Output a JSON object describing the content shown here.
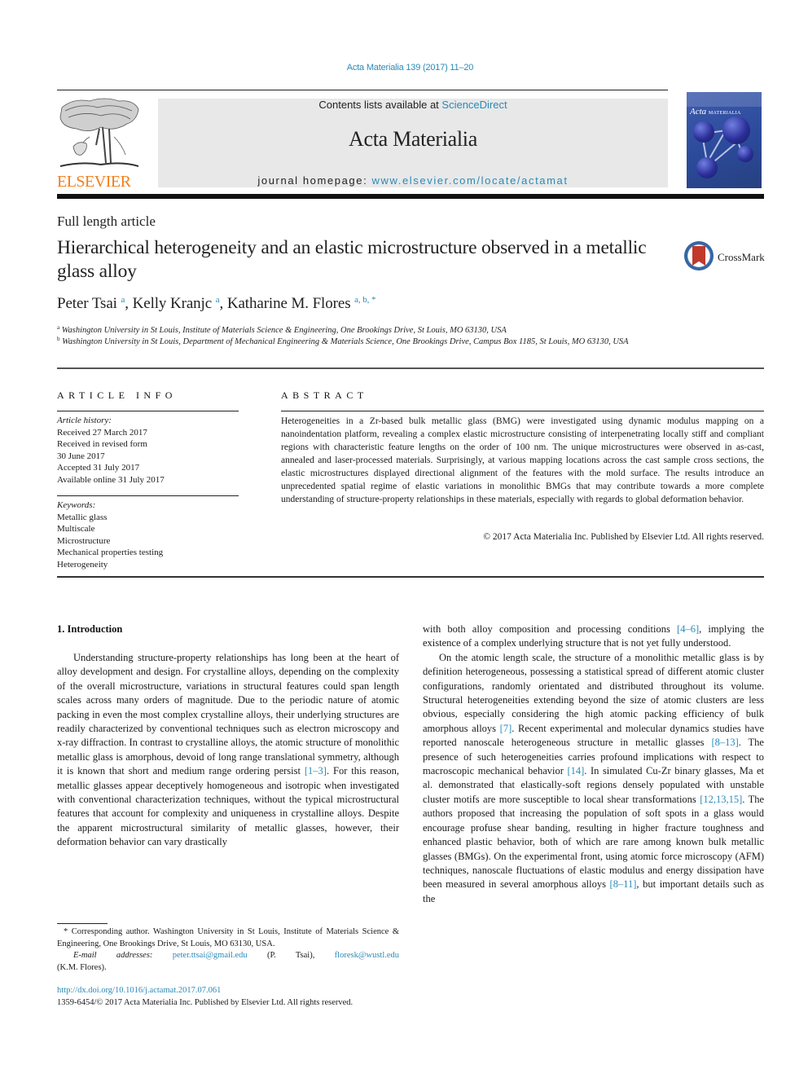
{
  "header": {
    "journal_ref": "Acta Materialia 139 (2017) 11–20",
    "contents_prefix": "Contents lists available at ",
    "contents_link": "ScienceDirect",
    "journal_title": "Acta Materialia",
    "homepage_prefix": "journal homepage: ",
    "homepage_url": "www.elsevier.com/locate/actamat",
    "publisher_logo_text": "ELSEVIER",
    "cover_title_italic": "Acta",
    "cover_title_caps": "MATERIALIA",
    "colors": {
      "link": "#2a8ab8",
      "elsevier_orange": "#f07e1b",
      "header_box": "#e8e8e8",
      "crossmark_red": "#c0392b"
    }
  },
  "article": {
    "type": "Full length article",
    "title": "Hierarchical heterogeneity and an elastic microstructure observed in a metallic glass alloy",
    "crossmark_label": "CrossMark",
    "authors": [
      {
        "name": "Peter Tsai",
        "sup": "a"
      },
      {
        "name": "Kelly Kranjc",
        "sup": "a"
      },
      {
        "name": "Katharine M. Flores",
        "sup": "a, b, *"
      }
    ],
    "affiliations": [
      {
        "mark": "a",
        "text": "Washington University in St Louis, Institute of Materials Science & Engineering, One Brookings Drive, St Louis, MO 63130, USA"
      },
      {
        "mark": "b",
        "text": "Washington University in St Louis, Department of Mechanical Engineering & Materials Science, One Brookings Drive, Campus Box 1185, St Louis, MO 63130, USA"
      }
    ]
  },
  "article_info": {
    "heading": "ARTICLE INFO",
    "history_label": "Article history:",
    "history": [
      "Received 27 March 2017",
      "Received in revised form",
      "30 June 2017",
      "Accepted 31 July 2017",
      "Available online 31 July 2017"
    ],
    "keywords_label": "Keywords:",
    "keywords": [
      "Metallic glass",
      "Multiscale",
      "Microstructure",
      "Mechanical properties testing",
      "Heterogeneity"
    ]
  },
  "abstract": {
    "heading": "ABSTRACT",
    "body": "Heterogeneities in a Zr-based bulk metallic glass (BMG) were investigated using dynamic modulus mapping on a nanoindentation platform, revealing a complex elastic microstructure consisting of interpenetrating locally stiff and compliant regions with characteristic feature lengths on the order of 100 nm. The unique microstructures were observed in as-cast, annealed and laser-processed materials. Surprisingly, at various mapping locations across the cast sample cross sections, the elastic micro­structures displayed directional alignment of the features with the mold surface. The results introduce an unprecedented spatial regime of elastic variations in monolithic BMGs that may contribute towards a more complete understanding of structure-property relationships in these materials, especially with regards to global deformation behavior.",
    "copyright": "© 2017 Acta Materialia Inc. Published by Elsevier Ltd. All rights reserved."
  },
  "introduction": {
    "heading": "1.  Introduction",
    "left_paragraph": [
      {
        "t": "Understanding structure-property relationships has long been at the heart of alloy development and design. For crystalline alloys, depending on the complexity of the overall microstructure, varia­tions in structural features could span length scales across many orders of magnitude. Due to the periodic nature of atomic packing in even the most complex crystalline alloys, their underlying structures are readily characterized by conventional techniques such as electron microscopy and x-ray diffraction. In contrast to crystalline alloys, the atomic structure of monolithic metallic glass is amorphous, devoid of long range translational symmetry, although it is known that short and medium range ordering persist "
      },
      {
        "ref": "[1–3]"
      },
      {
        "t": ". For this reason, metallic glasses appear deceptively homo­geneous and isotropic when investigated with conventional char­acterization techniques, without the typical microstructural features that account for complexity and uniqueness in crystalline alloys. Despite the apparent microstructural similarity of metallic glasses, however, their deformation behavior can vary drastically"
      }
    ],
    "right_paragraph_1": [
      {
        "t": "with both alloy composition and processing conditions "
      },
      {
        "ref": "[4–6]"
      },
      {
        "t": ", implying the existence of a complex underlying structure that is not yet fully understood."
      }
    ],
    "right_paragraph_2": [
      {
        "t": "On the atomic length scale, the structure of a monolithic metallic glass is by definition heterogeneous, possessing a statis­tical spread of different atomic cluster configurations, randomly orientated and distributed throughout its volume. Structural het­erogeneities extending beyond the size of atomic clusters are less obvious, especially considering the high atomic packing efficiency of bulk amorphous alloys "
      },
      {
        "ref": "[7]"
      },
      {
        "t": ". Recent experimental and molecular dynamics studies have reported nanoscale heterogeneous structure in metallic glasses "
      },
      {
        "ref": "[8–13]"
      },
      {
        "t": ". The presence of such heterogeneities carries profound implications with respect to macroscopic me­chanical behavior "
      },
      {
        "ref": "[14]"
      },
      {
        "t": ". In simulated Cu-Zr binary glasses, Ma et al. demonstrated that elastically-soft regions densely populated with unstable cluster motifs are more susceptible to local shear trans­formations "
      },
      {
        "ref": "[12,13,15]"
      },
      {
        "t": ". The authors proposed that increasing the population of soft spots in a glass would encourage profuse shear banding, resulting in higher fracture toughness and enhanced plastic behavior, both of which are rare among known bulk metallic glasses (BMGs). On the experimental front, using atomic force mi­croscopy (AFM) techniques, nanoscale fluctuations of elastic modulus and energy dissipation have been measured in several amorphous alloys "
      },
      {
        "ref": "[8–11]"
      },
      {
        "t": ", but important details such as the"
      }
    ]
  },
  "footnote": {
    "corresponding": "* Corresponding author. Washington University in St Louis, Institute of Materials Science & Engineering, One Brookings Drive, St Louis, MO 63130, USA.",
    "email_label": "E-mail addresses:",
    "email_1": "peter.ttsai@gmail.edu",
    "email_1_owner": "(P. Tsai),",
    "email_2": "floresk@wustl.edu",
    "email_2_owner": "(K.M. Flores).",
    "doi": "http://dx.doi.org/10.1016/j.actamat.2017.07.061",
    "issn": "1359-6454/© 2017 Acta Materialia Inc. Published by Elsevier Ltd. All rights reserved."
  }
}
